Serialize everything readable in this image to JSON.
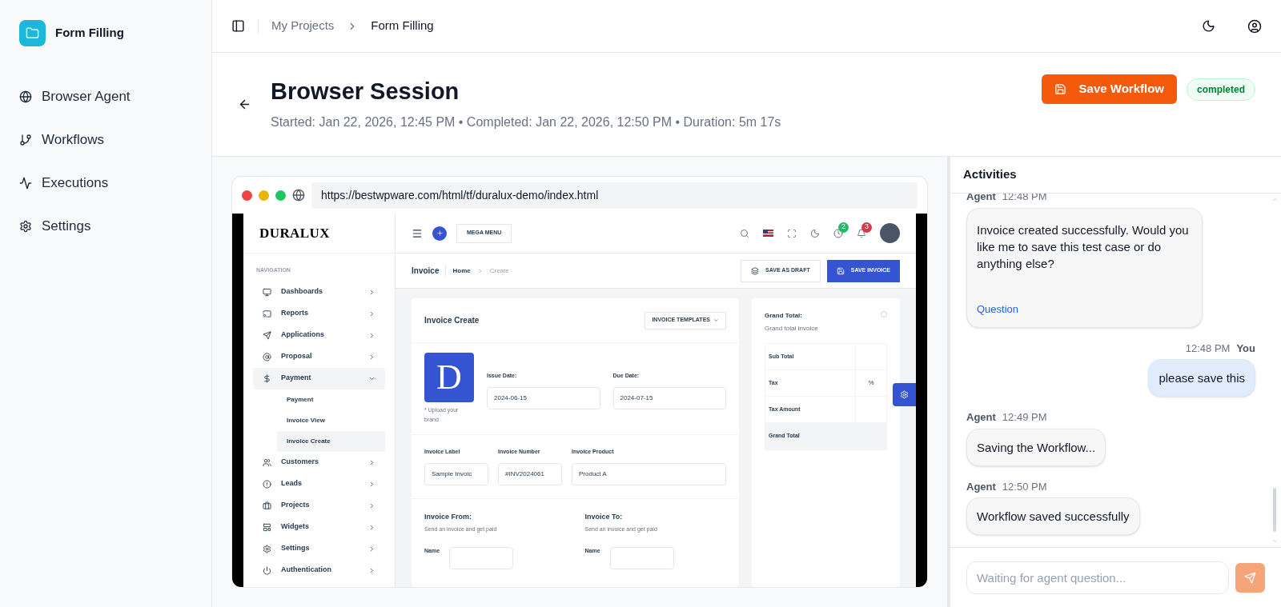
{
  "app": {
    "name": "Form Filling"
  },
  "nav": [
    {
      "label": "Browser Agent"
    },
    {
      "label": "Workflows"
    },
    {
      "label": "Executions"
    },
    {
      "label": "Settings"
    }
  ],
  "breadcrumb": [
    "My Projects",
    "Form Filling"
  ],
  "session": {
    "title": "Browser Session",
    "meta": "Started: Jan 22, 2026, 12:45 PM • Completed: Jan 22, 2026, 12:50 PM • Duration: 5m 17s",
    "save_button": "Save Workflow",
    "status": "completed"
  },
  "browser": {
    "url": "https://bestwpware.com/html/tf/duralux-demo/index.html",
    "page": {
      "logo": "DURALUX",
      "nav_heading": "NAVIGATION",
      "nav": [
        {
          "label": "Dashboards",
          "expanded": false
        },
        {
          "label": "Reports",
          "expanded": false
        },
        {
          "label": "Applications",
          "expanded": false
        },
        {
          "label": "Proposal",
          "expanded": false
        },
        {
          "label": "Payment",
          "expanded": true,
          "children": [
            {
              "label": "Payment",
              "selected": false
            },
            {
              "label": "Invoice View",
              "selected": false
            },
            {
              "label": "Invoice Create",
              "selected": true
            }
          ]
        },
        {
          "label": "Customers",
          "expanded": false
        },
        {
          "label": "Leads",
          "expanded": false
        },
        {
          "label": "Projects",
          "expanded": false
        },
        {
          "label": "Widgets",
          "expanded": false
        },
        {
          "label": "Settings",
          "expanded": false
        },
        {
          "label": "Authentication",
          "expanded": false
        }
      ],
      "mega_menu": "MEGA MENU",
      "badges": [
        "2",
        "3"
      ],
      "page_title": "Invoice",
      "crumbs": [
        "Home",
        "Create"
      ],
      "draft_button": "SAVE AS DRAFT",
      "save_button": "SAVE INVOICE",
      "card_title": "Invoice Create",
      "templates_button": "INVOICE TEMPLATES",
      "brand_letter": "D",
      "upload_note": "* Upload your brand",
      "dates": [
        {
          "label": "Issue Date:",
          "value": "2024-06-15"
        },
        {
          "label": "Due Date:",
          "value": "2024-07-15"
        }
      ],
      "fields": [
        {
          "label": "Invoice Label",
          "value": "Sample Invoic"
        },
        {
          "label": "Invoice Number",
          "value": "#INV2024061"
        },
        {
          "label": "Invoice Product",
          "value": "Product A"
        }
      ],
      "parties": [
        {
          "title": "Invoice From:",
          "subtitle": "Send an invoice and get paid",
          "name_label": "Name"
        },
        {
          "title": "Invoice To:",
          "subtitle": "Send an invoice and get paid",
          "name_label": "Name"
        }
      ],
      "totals": {
        "title": "Grand Total:",
        "subtitle": "Grand total invoice",
        "rows": [
          {
            "label": "Sub Total",
            "highlighted": false
          },
          {
            "label": "Tax",
            "value": "%",
            "highlighted": false
          },
          {
            "label": "Tax Amount",
            "highlighted": false
          },
          {
            "label": "Grand Total",
            "highlighted": true
          }
        ]
      }
    }
  },
  "activities": {
    "title": "Activities",
    "messages": [
      {
        "kind": "agent",
        "sender": "Agent",
        "time": "12:48 PM",
        "text": "Invoice created successfully. Would you like me to save this test case or do anything else?",
        "tag": "Question"
      },
      {
        "kind": "user",
        "sender": "You",
        "time": "12:48 PM",
        "text": "please save this"
      },
      {
        "kind": "agent",
        "sender": "Agent",
        "time": "12:49 PM",
        "text": "Saving the Workflow..."
      },
      {
        "kind": "agent",
        "sender": "Agent",
        "time": "12:50 PM",
        "text": "Workflow saved successfully"
      }
    ],
    "input_placeholder": "Waiting for agent question..."
  }
}
